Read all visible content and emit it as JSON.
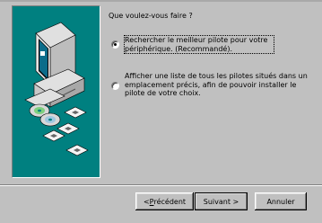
{
  "dialog": {
    "question": "Que voulez-vous faire ?",
    "options": [
      {
        "line1": "Rechercher le meilleur pilote pour votre",
        "line2": "périphérique. (Recommandé).",
        "selected": true
      },
      {
        "line1": "Afficher une liste de tous les pilotes situés dans un",
        "line2": "emplacement précis, afin de pouvoir installer le",
        "line3": "pilote de votre choix.",
        "selected": false
      }
    ]
  },
  "buttons": {
    "prev_prefix": "< ",
    "prev_accel": "P",
    "prev_rest": "récédent",
    "next_label": "Suivant >",
    "cancel_label": "Annuler"
  },
  "colors": {
    "background": "#c0c0c0",
    "illustration_bg": "#008080"
  },
  "icons": [
    "computer-icon",
    "cd-disc-icon",
    "floppy-disk-icon"
  ]
}
